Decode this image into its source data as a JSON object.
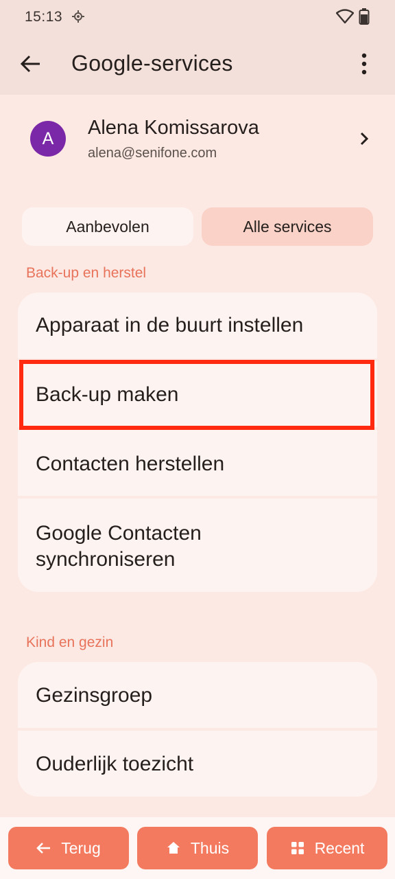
{
  "status": {
    "time": "15:13",
    "icons": [
      "location-icon",
      "wifi-icon",
      "battery-icon"
    ]
  },
  "appbar": {
    "title": "Google-services",
    "back_icon": "arrow-left-icon",
    "menu_icon": "more-vert-icon"
  },
  "account": {
    "initial": "A",
    "name": "Alena Komissarova",
    "email": "alena@senifone.com",
    "avatar_color": "#7b28a8"
  },
  "tabs": [
    {
      "label": "Aanbevolen",
      "selected": false
    },
    {
      "label": "Alle services",
      "selected": true
    }
  ],
  "sections": [
    {
      "label": "Back-up en herstel",
      "items": [
        "Apparaat in de buurt instellen",
        "Back-up maken",
        "Contacten herstellen",
        "Google Contacten synchroniseren"
      ]
    },
    {
      "label": "Kind en gezin",
      "items": [
        "Gezinsgroep",
        "Ouderlijk toezicht"
      ]
    }
  ],
  "highlighted_item": "Back-up maken",
  "navbar": {
    "back": "Terug",
    "home": "Thuis",
    "recent": "Recent"
  },
  "colors": {
    "accent": "#e8735b",
    "nav_button": "#f47a5f",
    "highlight": "#ff2a0f",
    "background": "#fde9e3"
  }
}
